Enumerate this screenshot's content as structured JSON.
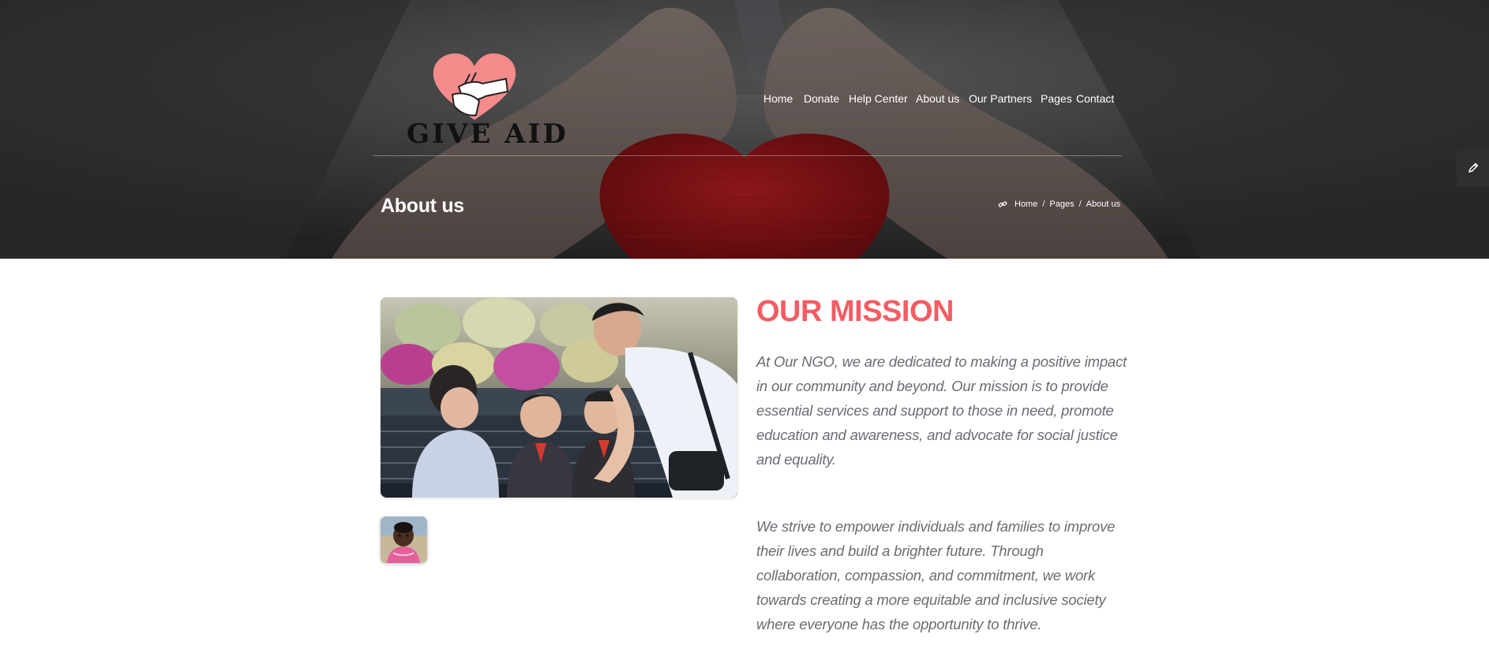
{
  "brand": {
    "logo_text": "GIVE AID",
    "colors": {
      "accent": "#f45c62",
      "heart": "#f58b8b",
      "text_muted": "#6b6b73"
    }
  },
  "nav": {
    "items": [
      {
        "label": "Home"
      },
      {
        "label": "Donate"
      },
      {
        "label": "Help Center"
      },
      {
        "label": "About us"
      },
      {
        "label": "Our Partners"
      },
      {
        "label": "Pages"
      },
      {
        "label": "Contact"
      }
    ]
  },
  "hero": {
    "title": "About us",
    "breadcrumb": {
      "icon": "link-icon",
      "items": [
        "Home",
        "Pages",
        "About us"
      ],
      "separator": "/"
    }
  },
  "sidebar_tool": {
    "icon": "pencil-icon"
  },
  "mission": {
    "title": "OUR MISSION",
    "paragraphs": [
      "At Our NGO, we are dedicated to making a positive impact in our community and beyond. Our mission is to provide essential services and support to those in need, promote education and awareness, and advocate for social justice and equality.",
      "We strive to empower individuals and families to improve their lives and build a brighter future. Through collaboration, compassion, and commitment, we work towards creating a more equitable and inclusive society where everyone has the opportunity to thrive."
    ]
  }
}
